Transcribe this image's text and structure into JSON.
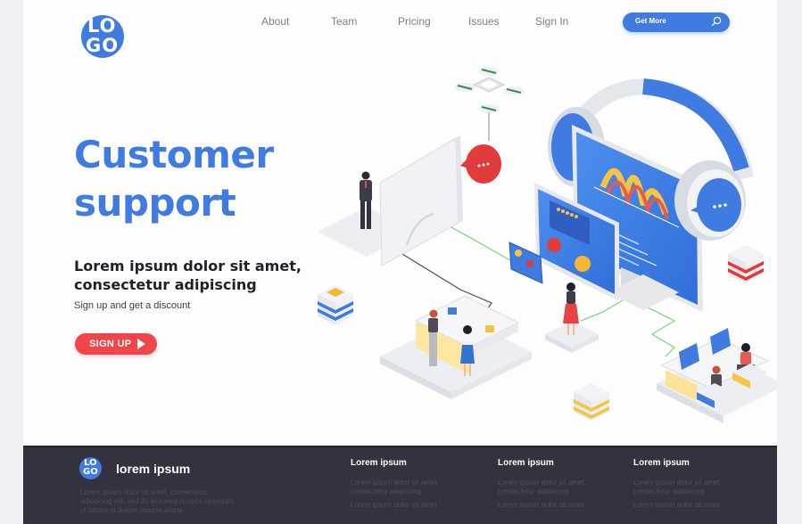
{
  "header": {
    "logo_text": [
      "LO",
      "GO"
    ],
    "nav": [
      {
        "label": "About"
      },
      {
        "label": "Team"
      },
      {
        "label": "Pricing"
      },
      {
        "label": "Issues"
      },
      {
        "label": "Sign In"
      }
    ],
    "search": {
      "label": "Get More",
      "icon": "search-icon"
    }
  },
  "hero": {
    "title_line1": "Customer",
    "title_line2": "support",
    "subtitle_line1": "Lorem ipsum dolor sit amet,",
    "subtitle_line2": "consectetur adipiscing",
    "note": "Sign up and get a discount",
    "cta_label": "SIGN UP",
    "cta_icon": "play-icon"
  },
  "illustration": {
    "description": "Isometric customer support scene: headset over monitor with charts, drone carrying chat bubble, people at desks",
    "colors": {
      "blue": "#3f7be0",
      "red": "#e23b3b",
      "yellow": "#f5c542",
      "green": "#5fd06a",
      "gray": "#e9ebef"
    }
  },
  "footer": {
    "logo_text": [
      "LO",
      "GO"
    ],
    "brand": "lorem ipsum",
    "description": "Lorem ipsum dolor sit amet, consectetur adipiscing elit, sed do eiusmod tempor incididunt ut labore et dolore magna aliqua",
    "columns": [
      {
        "title": "Lorem ipsum",
        "lines": [
          "Lorem ipsum dolor sit amet, consectetur adipiscing",
          "Lorem ipsum dolor sit amet"
        ]
      },
      {
        "title": "Lorem ipsum",
        "lines": [
          "Lorem ipsum dolor sit amet, consectetur adipiscing",
          "Lorem ipsum dolor sit amet"
        ]
      },
      {
        "title": "Lorem ipsum",
        "lines": [
          "Lorem ipsum dolor sit amet, consectetur adipiscing",
          "Lorem ipsum dolor sit amet"
        ]
      }
    ]
  },
  "colors": {
    "accent": "#3f7be0",
    "cta": "#f0464a",
    "footer_bg": "#33333f",
    "page_bg": "#eef0f3"
  }
}
